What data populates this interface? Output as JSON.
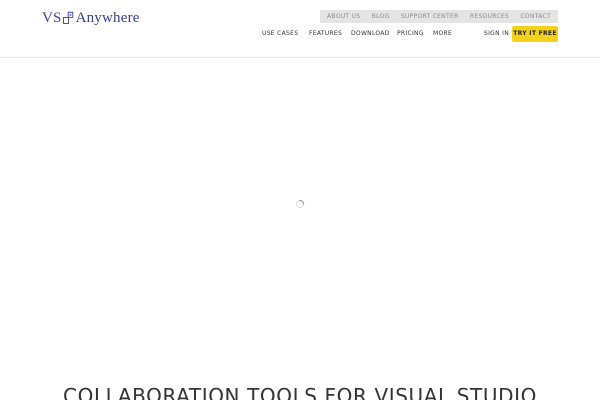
{
  "header": {
    "logo": {
      "text_left": "VS",
      "text_right": "Anywhere",
      "mark_icon": "vs-anywhere-logo-mark"
    },
    "top_links": [
      {
        "label": "ABOUT US"
      },
      {
        "label": "BLOG"
      },
      {
        "label": "SUPPORT CENTER"
      },
      {
        "label": "RESOURCES"
      },
      {
        "label": "CONTACT"
      }
    ],
    "main_nav": [
      {
        "label": "USE CASES"
      },
      {
        "label": "FEATURES"
      },
      {
        "label": "DOWNLOAD"
      },
      {
        "label": "PRICING"
      },
      {
        "label": "MORE"
      }
    ],
    "sign_in": "SIGN IN",
    "cta": "TRY IT FREE"
  },
  "main": {
    "loading_icon": "spinner-icon",
    "hero_heading": "COLLABORATION TOOLS FOR VISUAL STUDIO"
  },
  "colors": {
    "brand_text": "#3c3f8f",
    "cta_background": "#f2d21b",
    "topbar_background": "#e4e4e4"
  }
}
